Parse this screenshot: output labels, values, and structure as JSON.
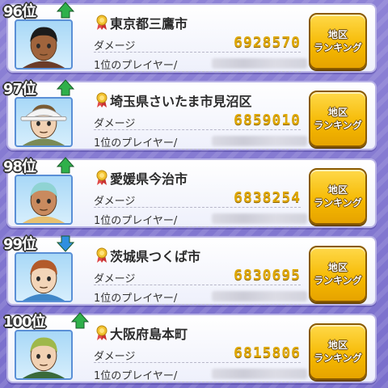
{
  "rows": [
    {
      "rank": "96位",
      "trend": "up",
      "area": "東京都三鷹市",
      "damage_label": "ダメージ",
      "damage": "6928570",
      "player_label": "1位のプレイヤー/",
      "button_line1": "地区",
      "button_line2": "ランキング",
      "avatar": {
        "skin": "#a0643c",
        "hair": "#1b1b1b",
        "hat": "",
        "shirt": "#6a3c28"
      }
    },
    {
      "rank": "97位",
      "trend": "up",
      "area": "埼玉県さいたま市見沼区",
      "damage_label": "ダメージ",
      "damage": "6859010",
      "player_label": "1位のプレイヤー/",
      "button_line1": "地区",
      "button_line2": "ランキング",
      "avatar": {
        "skin": "#f1d1b3",
        "hair": "#7a5a32",
        "hat": "#f4f4f4",
        "shirt": "#7a8a56"
      }
    },
    {
      "rank": "98位",
      "trend": "up",
      "area": "愛媛県今治市",
      "damage_label": "ダメージ",
      "damage": "6838254",
      "player_label": "1位のプレイヤー/",
      "button_line1": "地区",
      "button_line2": "ランキング",
      "avatar": {
        "skin": "#c98a5e",
        "hair": "#8fd3d3",
        "hat": "",
        "shirt": "#e8c070"
      }
    },
    {
      "rank": "99位",
      "trend": "down",
      "area": "茨城県つくば市",
      "damage_label": "ダメージ",
      "damage": "6830695",
      "player_label": "1位のプレイヤー/",
      "button_line1": "地区",
      "button_line2": "ランキング",
      "avatar": {
        "skin": "#f3d5b8",
        "hair": "#b35a2a",
        "hat": "",
        "shirt": "#3f86c8"
      }
    },
    {
      "rank": "100位",
      "trend": "up",
      "area": "大阪府島本町",
      "damage_label": "ダメージ",
      "damage": "6815806",
      "player_label": "1位のプレイヤー/",
      "button_line1": "地区",
      "button_line2": "ランキング",
      "avatar": {
        "skin": "#f1d1b3",
        "hair": "#9fb84a",
        "hat": "",
        "shirt": "#3a6a3a"
      }
    }
  ],
  "colors": {
    "up": "#2fb04a",
    "down": "#2f8fe0",
    "damage": "#e0a800",
    "button": "#f5b800"
  }
}
